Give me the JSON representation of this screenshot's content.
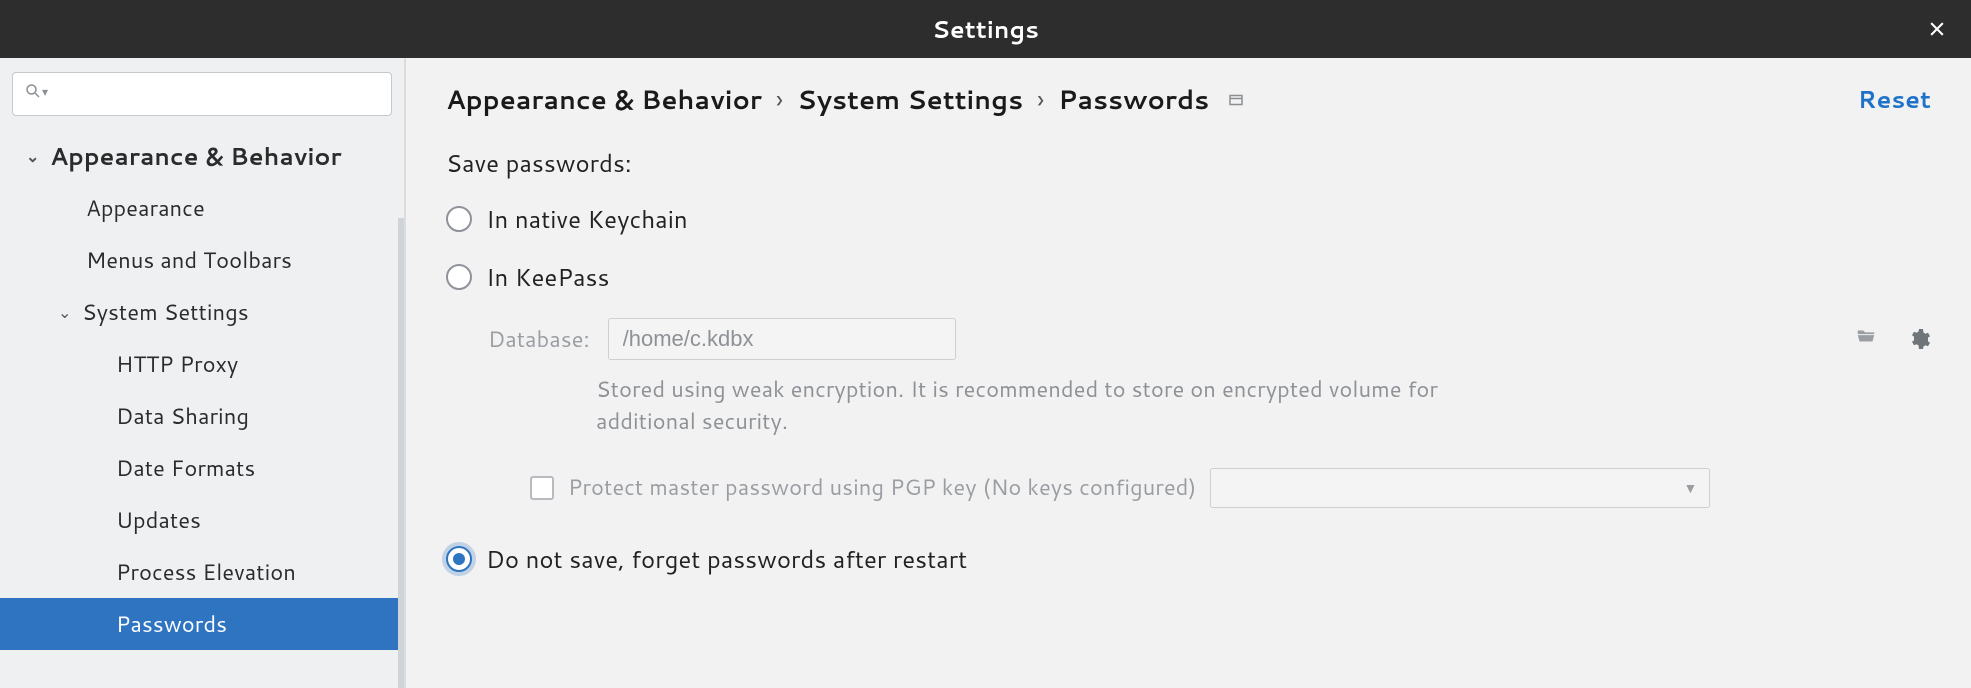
{
  "titlebar": {
    "title": "Settings"
  },
  "sidebar": {
    "search_placeholder": "",
    "tree": {
      "root_label": "Appearance & Behavior",
      "items": [
        "Appearance",
        "Menus and Toolbars"
      ],
      "system_settings_label": "System Settings",
      "system_items": [
        "HTTP Proxy",
        "Data Sharing",
        "Date Formats",
        "Updates",
        "Process Elevation",
        "Passwords"
      ]
    }
  },
  "breadcrumbs": {
    "a": "Appearance & Behavior",
    "b": "System Settings",
    "c": "Passwords"
  },
  "reset_label": "Reset",
  "section": {
    "save_passwords_label": "Save passwords:",
    "opt_keychain": "In native Keychain",
    "opt_keepass": "In KeePass",
    "database_label": "Database:",
    "database_value": "/home/c.kdbx",
    "database_hint": "Stored using weak encryption. It is recommended to store on encrypted volume for additional security.",
    "pgp_label": "Protect master password using PGP key (No keys configured)",
    "opt_donotsave": "Do not save, forget passwords after restart"
  }
}
